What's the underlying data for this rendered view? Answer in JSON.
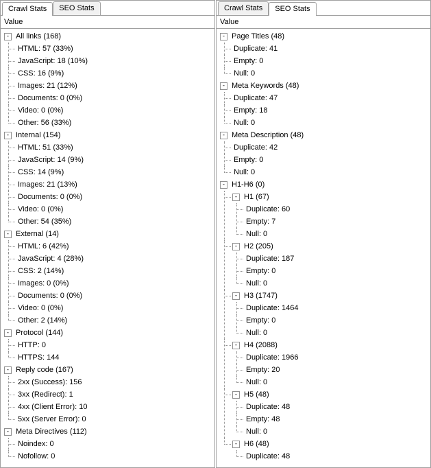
{
  "left": {
    "tabs": [
      {
        "label": "Crawl Stats",
        "active": true
      },
      {
        "label": "SEO Stats",
        "active": false
      }
    ],
    "header": "Value",
    "tree": [
      {
        "label": "All links (168)",
        "children": [
          {
            "label": "HTML: 57 (33%)"
          },
          {
            "label": "JavaScript: 18 (10%)"
          },
          {
            "label": "CSS: 16 (9%)"
          },
          {
            "label": "Images: 21 (12%)"
          },
          {
            "label": "Documents: 0 (0%)"
          },
          {
            "label": "Video: 0 (0%)"
          },
          {
            "label": "Other: 56 (33%)"
          }
        ]
      },
      {
        "label": "Internal (154)",
        "children": [
          {
            "label": "HTML: 51 (33%)"
          },
          {
            "label": "JavaScript: 14 (9%)"
          },
          {
            "label": "CSS: 14 (9%)"
          },
          {
            "label": "Images: 21 (13%)"
          },
          {
            "label": "Documents: 0 (0%)"
          },
          {
            "label": "Video: 0 (0%)"
          },
          {
            "label": "Other: 54 (35%)"
          }
        ]
      },
      {
        "label": "External (14)",
        "children": [
          {
            "label": "HTML: 6 (42%)"
          },
          {
            "label": "JavaScript: 4 (28%)"
          },
          {
            "label": "CSS: 2 (14%)"
          },
          {
            "label": "Images: 0 (0%)"
          },
          {
            "label": "Documents: 0 (0%)"
          },
          {
            "label": "Video: 0 (0%)"
          },
          {
            "label": "Other: 2 (14%)"
          }
        ]
      },
      {
        "label": "Protocol (144)",
        "children": [
          {
            "label": "HTTP: 0"
          },
          {
            "label": "HTTPS: 144"
          }
        ]
      },
      {
        "label": "Reply code (167)",
        "children": [
          {
            "label": "2xx (Success): 156"
          },
          {
            "label": "3xx (Redirect): 1"
          },
          {
            "label": "4xx (Client Error): 10"
          },
          {
            "label": "5xx (Server Error): 0"
          }
        ]
      },
      {
        "label": "Meta Directives (112)",
        "children": [
          {
            "label": "Noindex: 0"
          },
          {
            "label": "Nofollow: 0"
          }
        ]
      }
    ]
  },
  "right": {
    "tabs": [
      {
        "label": "Crawl Stats",
        "active": false
      },
      {
        "label": "SEO Stats",
        "active": true
      }
    ],
    "header": "Value",
    "tree": [
      {
        "label": "Page Titles (48)",
        "children": [
          {
            "label": "Duplicate: 41"
          },
          {
            "label": "Empty: 0"
          },
          {
            "label": "Null: 0"
          }
        ]
      },
      {
        "label": "Meta Keywords (48)",
        "children": [
          {
            "label": "Duplicate: 47"
          },
          {
            "label": "Empty: 18"
          },
          {
            "label": "Null: 0"
          }
        ]
      },
      {
        "label": "Meta Description (48)",
        "children": [
          {
            "label": "Duplicate: 42"
          },
          {
            "label": "Empty: 0"
          },
          {
            "label": "Null: 0"
          }
        ]
      },
      {
        "label": "H1-H6 (0)",
        "children": [
          {
            "label": "H1 (67)",
            "children": [
              {
                "label": "Duplicate: 60"
              },
              {
                "label": "Empty: 7"
              },
              {
                "label": "Null: 0"
              }
            ]
          },
          {
            "label": "H2 (205)",
            "children": [
              {
                "label": "Duplicate: 187"
              },
              {
                "label": "Empty: 0"
              },
              {
                "label": "Null: 0"
              }
            ]
          },
          {
            "label": "H3 (1747)",
            "children": [
              {
                "label": "Duplicate: 1464"
              },
              {
                "label": "Empty: 0"
              },
              {
                "label": "Null: 0"
              }
            ]
          },
          {
            "label": "H4 (2088)",
            "children": [
              {
                "label": "Duplicate: 1966"
              },
              {
                "label": "Empty: 20"
              },
              {
                "label": "Null: 0"
              }
            ]
          },
          {
            "label": "H5 (48)",
            "children": [
              {
                "label": "Duplicate: 48"
              },
              {
                "label": "Empty: 48"
              },
              {
                "label": "Null: 0"
              }
            ]
          },
          {
            "label": "H6 (48)",
            "children": [
              {
                "label": "Duplicate: 48"
              }
            ]
          }
        ]
      }
    ]
  },
  "glyphs": {
    "minus": "-"
  }
}
